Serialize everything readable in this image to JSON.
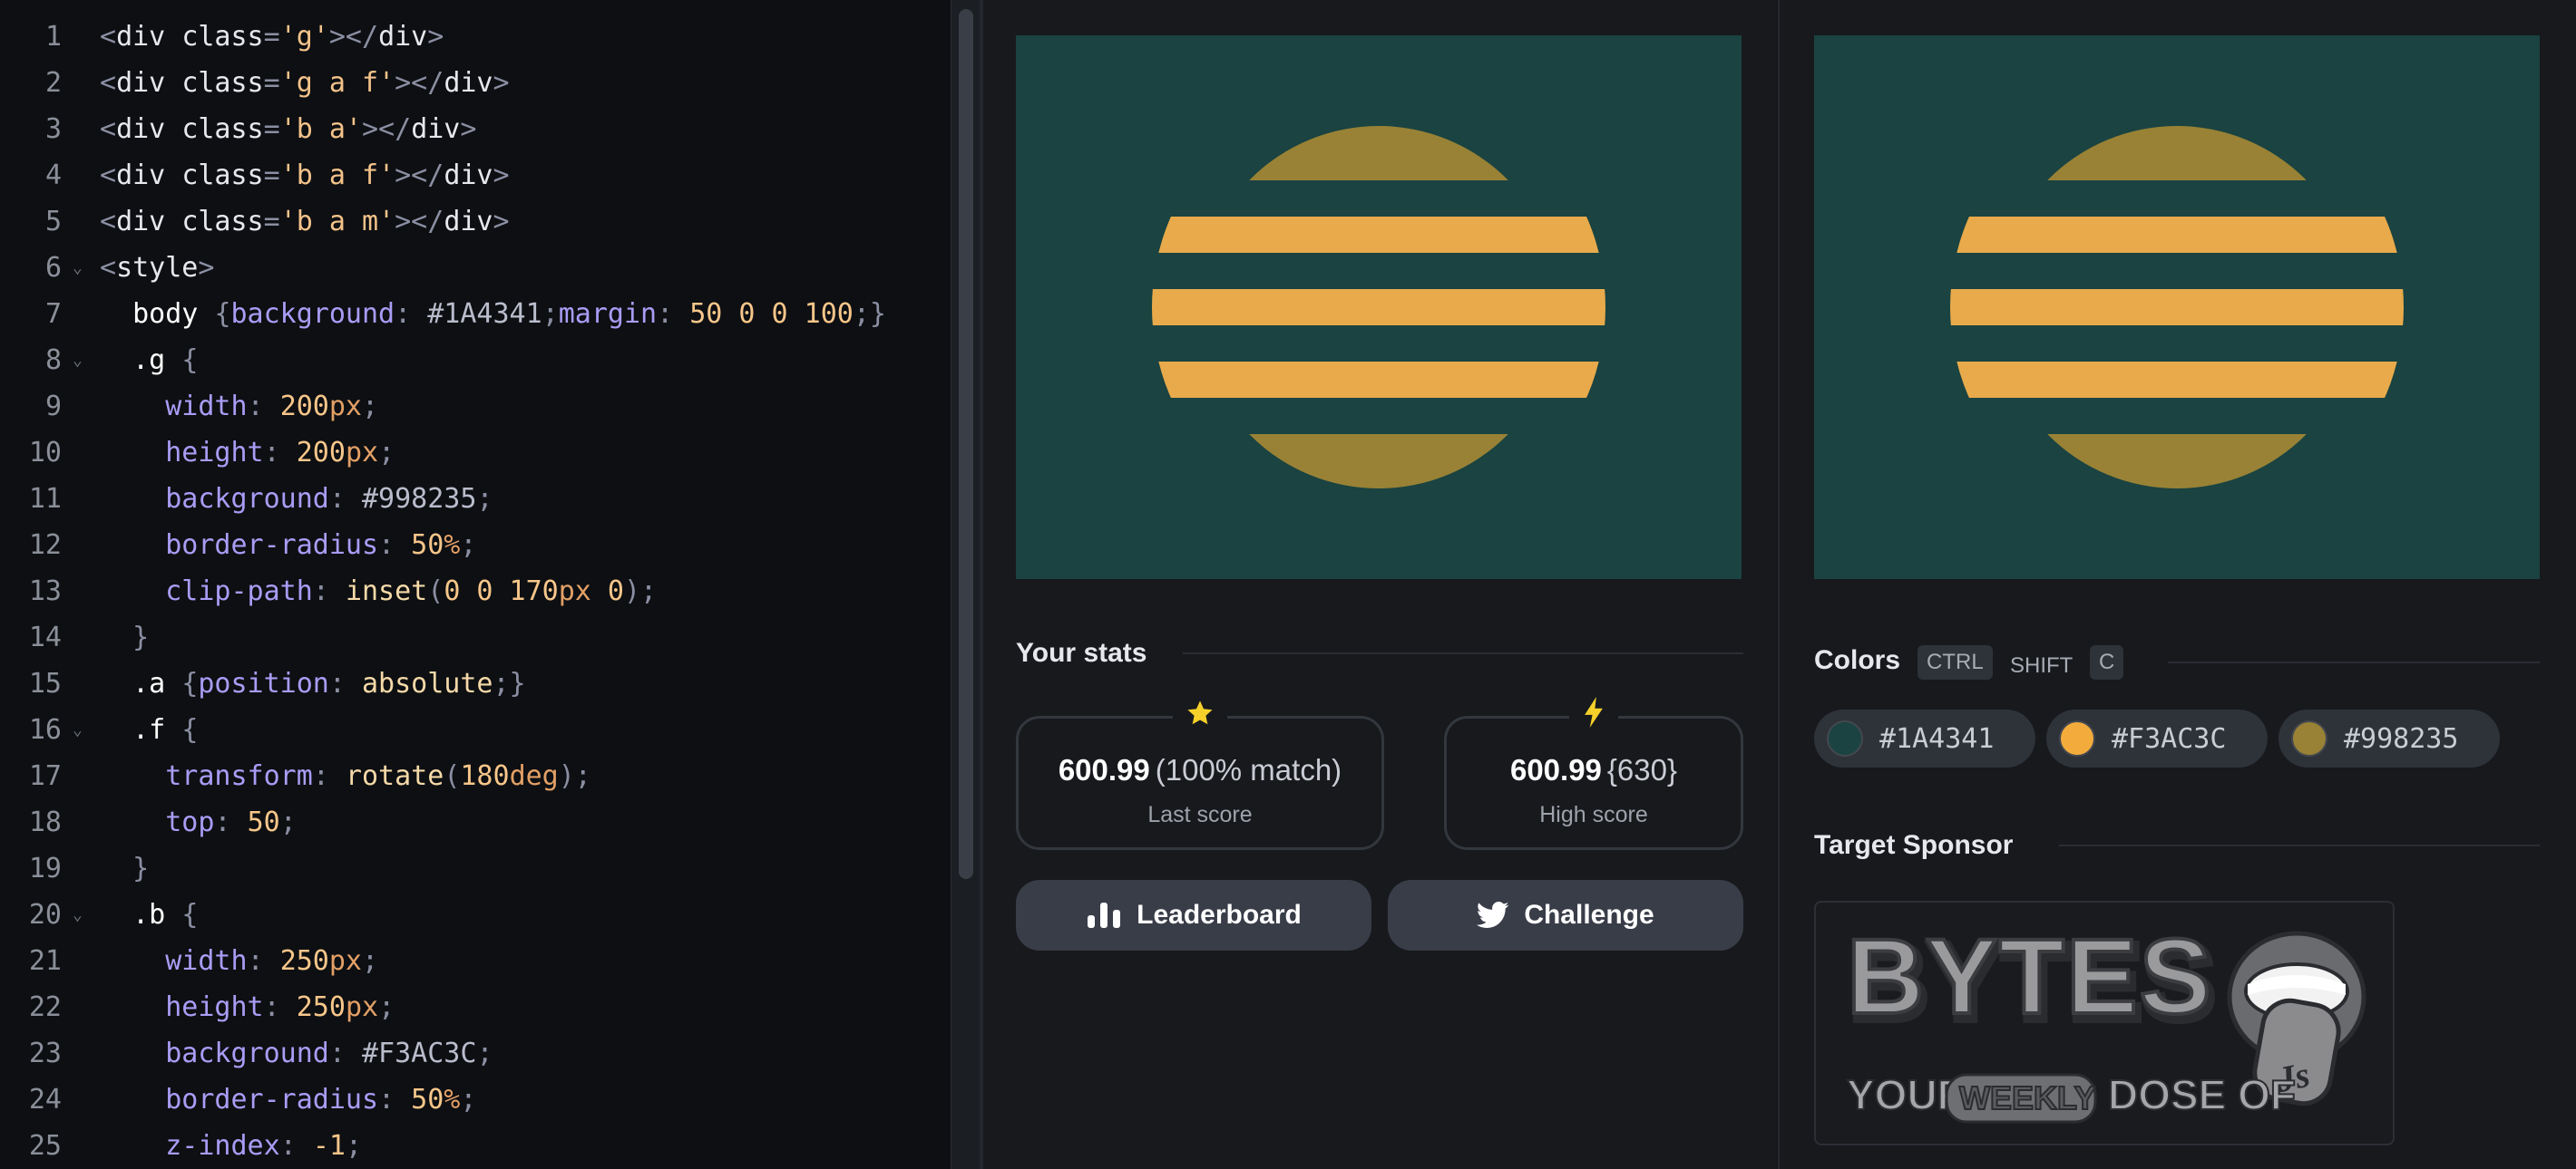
{
  "editor": {
    "lines": [
      {
        "n": "1",
        "fold": false,
        "tokens": [
          [
            "t-pun",
            "<"
          ],
          [
            "t-tag",
            "div "
          ],
          [
            "t-attr",
            "class"
          ],
          [
            "t-pun",
            "="
          ],
          [
            "t-str",
            "'g'"
          ],
          [
            "t-pun",
            "></"
          ],
          [
            "t-tag",
            "div"
          ],
          [
            "t-pun",
            ">"
          ]
        ]
      },
      {
        "n": "2",
        "fold": false,
        "tokens": [
          [
            "t-pun",
            "<"
          ],
          [
            "t-tag",
            "div "
          ],
          [
            "t-attr",
            "class"
          ],
          [
            "t-pun",
            "="
          ],
          [
            "t-str",
            "'g a f'"
          ],
          [
            "t-pun",
            "></"
          ],
          [
            "t-tag",
            "div"
          ],
          [
            "t-pun",
            ">"
          ]
        ]
      },
      {
        "n": "3",
        "fold": false,
        "tokens": [
          [
            "t-pun",
            "<"
          ],
          [
            "t-tag",
            "div "
          ],
          [
            "t-attr",
            "class"
          ],
          [
            "t-pun",
            "="
          ],
          [
            "t-str",
            "'b a'"
          ],
          [
            "t-pun",
            "></"
          ],
          [
            "t-tag",
            "div"
          ],
          [
            "t-pun",
            ">"
          ]
        ]
      },
      {
        "n": "4",
        "fold": false,
        "tokens": [
          [
            "t-pun",
            "<"
          ],
          [
            "t-tag",
            "div "
          ],
          [
            "t-attr",
            "class"
          ],
          [
            "t-pun",
            "="
          ],
          [
            "t-str",
            "'b a f'"
          ],
          [
            "t-pun",
            "></"
          ],
          [
            "t-tag",
            "div"
          ],
          [
            "t-pun",
            ">"
          ]
        ]
      },
      {
        "n": "5",
        "fold": false,
        "tokens": [
          [
            "t-pun",
            "<"
          ],
          [
            "t-tag",
            "div "
          ],
          [
            "t-attr",
            "class"
          ],
          [
            "t-pun",
            "="
          ],
          [
            "t-str",
            "'b a m'"
          ],
          [
            "t-pun",
            "></"
          ],
          [
            "t-tag",
            "div"
          ],
          [
            "t-pun",
            ">"
          ]
        ]
      },
      {
        "n": "6",
        "fold": true,
        "tokens": [
          [
            "t-pun",
            "<"
          ],
          [
            "t-tag",
            "style"
          ],
          [
            "t-pun",
            ">"
          ]
        ]
      },
      {
        "n": "7",
        "fold": false,
        "tokens": [
          [
            "t-sel",
            "  body "
          ],
          [
            "t-pun",
            "{"
          ],
          [
            "t-prop",
            "background"
          ],
          [
            "t-pun",
            ": "
          ],
          [
            "t-hex",
            "#1A4341"
          ],
          [
            "t-pun",
            ";"
          ],
          [
            "t-prop",
            "margin"
          ],
          [
            "t-pun",
            ": "
          ],
          [
            "t-num",
            "50 0 0 100"
          ],
          [
            "t-pun",
            ";}"
          ]
        ]
      },
      {
        "n": "8",
        "fold": true,
        "tokens": [
          [
            "t-sel",
            "  .g "
          ],
          [
            "t-pun",
            "{"
          ]
        ]
      },
      {
        "n": "9",
        "fold": false,
        "tokens": [
          [
            "t-prop",
            "    width"
          ],
          [
            "t-pun",
            ": "
          ],
          [
            "t-num",
            "200"
          ],
          [
            "t-unit",
            "px"
          ],
          [
            "t-pun",
            ";"
          ]
        ]
      },
      {
        "n": "10",
        "fold": false,
        "tokens": [
          [
            "t-prop",
            "    height"
          ],
          [
            "t-pun",
            ": "
          ],
          [
            "t-num",
            "200"
          ],
          [
            "t-unit",
            "px"
          ],
          [
            "t-pun",
            ";"
          ]
        ]
      },
      {
        "n": "11",
        "fold": false,
        "tokens": [
          [
            "t-prop",
            "    background"
          ],
          [
            "t-pun",
            ": "
          ],
          [
            "t-hex",
            "#998235"
          ],
          [
            "t-pun",
            ";"
          ]
        ]
      },
      {
        "n": "12",
        "fold": false,
        "tokens": [
          [
            "t-prop",
            "    border-radius"
          ],
          [
            "t-pun",
            ": "
          ],
          [
            "t-num",
            "50"
          ],
          [
            "t-unit",
            "%"
          ],
          [
            "t-pun",
            ";"
          ]
        ]
      },
      {
        "n": "13",
        "fold": false,
        "tokens": [
          [
            "t-prop",
            "    clip-path"
          ],
          [
            "t-pun",
            ": "
          ],
          [
            "t-fn",
            "inset"
          ],
          [
            "t-pun",
            "("
          ],
          [
            "t-num",
            "0 0 170"
          ],
          [
            "t-unit",
            "px"
          ],
          [
            "t-num",
            " 0"
          ],
          [
            "t-pun",
            ");"
          ]
        ]
      },
      {
        "n": "14",
        "fold": false,
        "tokens": [
          [
            "t-pun",
            "  }"
          ]
        ]
      },
      {
        "n": "15",
        "fold": false,
        "tokens": [
          [
            "t-sel",
            "  .a "
          ],
          [
            "t-pun",
            "{"
          ],
          [
            "t-prop",
            "position"
          ],
          [
            "t-pun",
            ": "
          ],
          [
            "t-kw",
            "absolute"
          ],
          [
            "t-pun",
            ";}"
          ]
        ]
      },
      {
        "n": "16",
        "fold": true,
        "tokens": [
          [
            "t-sel",
            "  .f "
          ],
          [
            "t-pun",
            "{"
          ]
        ]
      },
      {
        "n": "17",
        "fold": false,
        "tokens": [
          [
            "t-prop",
            "    transform"
          ],
          [
            "t-pun",
            ": "
          ],
          [
            "t-fn",
            "rotate"
          ],
          [
            "t-pun",
            "("
          ],
          [
            "t-num",
            "180"
          ],
          [
            "t-unit",
            "deg"
          ],
          [
            "t-pun",
            ");"
          ]
        ]
      },
      {
        "n": "18",
        "fold": false,
        "tokens": [
          [
            "t-prop",
            "    top"
          ],
          [
            "t-pun",
            ": "
          ],
          [
            "t-num",
            "50"
          ],
          [
            "t-pun",
            ";"
          ]
        ]
      },
      {
        "n": "19",
        "fold": false,
        "tokens": [
          [
            "t-pun",
            "  }"
          ]
        ]
      },
      {
        "n": "20",
        "fold": true,
        "tokens": [
          [
            "t-sel",
            "  .b "
          ],
          [
            "t-pun",
            "{"
          ]
        ]
      },
      {
        "n": "21",
        "fold": false,
        "tokens": [
          [
            "t-prop",
            "    width"
          ],
          [
            "t-pun",
            ": "
          ],
          [
            "t-num",
            "250"
          ],
          [
            "t-unit",
            "px"
          ],
          [
            "t-pun",
            ";"
          ]
        ]
      },
      {
        "n": "22",
        "fold": false,
        "tokens": [
          [
            "t-prop",
            "    height"
          ],
          [
            "t-pun",
            ": "
          ],
          [
            "t-num",
            "250"
          ],
          [
            "t-unit",
            "px"
          ],
          [
            "t-pun",
            ";"
          ]
        ]
      },
      {
        "n": "23",
        "fold": false,
        "tokens": [
          [
            "t-prop",
            "    background"
          ],
          [
            "t-pun",
            ": "
          ],
          [
            "t-hex",
            "#F3AC3C"
          ],
          [
            "t-pun",
            ";"
          ]
        ]
      },
      {
        "n": "24",
        "fold": false,
        "tokens": [
          [
            "t-prop",
            "    border-radius"
          ],
          [
            "t-pun",
            ": "
          ],
          [
            "t-num",
            "50"
          ],
          [
            "t-unit",
            "%"
          ],
          [
            "t-pun",
            ";"
          ]
        ]
      },
      {
        "n": "25",
        "fold": false,
        "tokens": [
          [
            "t-prop",
            "    z-index"
          ],
          [
            "t-pun",
            ": "
          ],
          [
            "t-num",
            "-1"
          ],
          [
            "t-pun",
            ";"
          ]
        ]
      }
    ]
  },
  "canvas": {
    "background": "#1A4341",
    "dark_circle": "#998235",
    "stripe": "#E8AA4B"
  },
  "stats": {
    "title": "Your stats",
    "last": {
      "icon": "star-icon",
      "value": "600.99",
      "extra": "(100% match)",
      "label": "Last score"
    },
    "high": {
      "icon": "lightning-icon",
      "value": "600.99",
      "extra": "{630}",
      "label": "High score"
    }
  },
  "buttons": {
    "leaderboard": "Leaderboard",
    "challenge": "Challenge"
  },
  "colors": {
    "title": "Colors",
    "shortcut": [
      "CTRL",
      "SHIFT",
      "C"
    ],
    "swatches": [
      {
        "hex": "#1A4341",
        "label": "#1A4341"
      },
      {
        "hex": "#F3AC3C",
        "label": "#F3AC3C"
      },
      {
        "hex": "#998235",
        "label": "#998235"
      }
    ]
  },
  "sponsor": {
    "title": "Target Sponsor",
    "logo_text": "BYTES",
    "tagline_1": "YOUR",
    "tagline_badge": "WEEKLY",
    "tagline_2": "DOSE OF",
    "js_badge": "Js"
  }
}
